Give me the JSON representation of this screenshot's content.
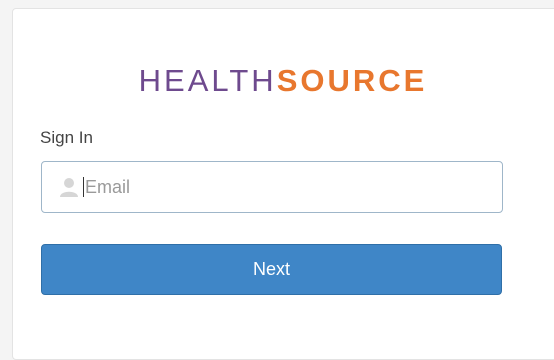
{
  "brand": {
    "part1": "HEALTH",
    "part2": "SOURCE",
    "part1_color": "#6e4a8e",
    "part2_color": "#e8772e"
  },
  "form": {
    "heading": "Sign In",
    "email": {
      "placeholder": "Email",
      "value": "",
      "icon": "user-icon"
    },
    "next_label": "Next",
    "button_color": "#3f86c7"
  }
}
